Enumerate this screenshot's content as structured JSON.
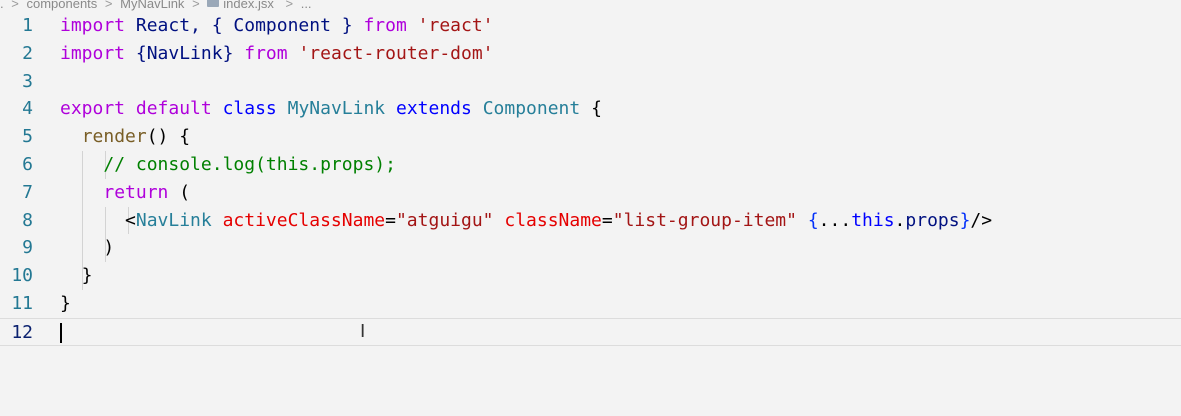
{
  "breadcrumb": {
    "items": [
      "components",
      "MyNavLink",
      "index.jsx",
      "..."
    ],
    "separator": ">"
  },
  "editor": {
    "language": "javascript-react",
    "cursor_line": 12,
    "lines": [
      {
        "number": "1",
        "segments": [
          {
            "t": "import",
            "c": "kw"
          },
          {
            "t": " React, { Component } ",
            "c": "id"
          },
          {
            "t": "from",
            "c": "kw"
          },
          {
            "t": " ",
            "c": "tx"
          },
          {
            "t": "'react'",
            "c": "st"
          }
        ]
      },
      {
        "number": "2",
        "segments": [
          {
            "t": "import",
            "c": "kw"
          },
          {
            "t": " {NavLink} ",
            "c": "id"
          },
          {
            "t": "from",
            "c": "kw"
          },
          {
            "t": " ",
            "c": "tx"
          },
          {
            "t": "'react-router-dom'",
            "c": "st"
          }
        ]
      },
      {
        "number": "3",
        "segments": []
      },
      {
        "number": "4",
        "segments": [
          {
            "t": "export",
            "c": "kw"
          },
          {
            "t": " ",
            "c": "tx"
          },
          {
            "t": "default",
            "c": "kw"
          },
          {
            "t": " ",
            "c": "tx"
          },
          {
            "t": "class",
            "c": "kb"
          },
          {
            "t": " ",
            "c": "tx"
          },
          {
            "t": "MyNavLink",
            "c": "ty"
          },
          {
            "t": " ",
            "c": "tx"
          },
          {
            "t": "extends",
            "c": "kb"
          },
          {
            "t": " ",
            "c": "tx"
          },
          {
            "t": "Component",
            "c": "ty"
          },
          {
            "t": " {",
            "c": "tx"
          }
        ]
      },
      {
        "number": "5",
        "segments": [
          {
            "t": "  ",
            "c": "tx"
          },
          {
            "t": "render",
            "c": "fn"
          },
          {
            "t": "() {",
            "c": "tx"
          }
        ]
      },
      {
        "number": "6",
        "segments": [
          {
            "t": "    ",
            "c": "tx"
          },
          {
            "t": "// console.log(this.props);",
            "c": "cm"
          }
        ]
      },
      {
        "number": "7",
        "segments": [
          {
            "t": "    ",
            "c": "tx"
          },
          {
            "t": "return",
            "c": "kw"
          },
          {
            "t": " (",
            "c": "tx"
          }
        ]
      },
      {
        "number": "8",
        "segments": [
          {
            "t": "      <",
            "c": "tx"
          },
          {
            "t": "NavLink",
            "c": "ty"
          },
          {
            "t": " ",
            "c": "tx"
          },
          {
            "t": "activeClassName",
            "c": "at"
          },
          {
            "t": "=",
            "c": "tx"
          },
          {
            "t": "\"atguigu\"",
            "c": "st"
          },
          {
            "t": " ",
            "c": "tx"
          },
          {
            "t": "className",
            "c": "at"
          },
          {
            "t": "=",
            "c": "tx"
          },
          {
            "t": "\"list-group-item\"",
            "c": "st"
          },
          {
            "t": " ",
            "c": "tx"
          },
          {
            "t": "{",
            "c": "br"
          },
          {
            "t": "...",
            "c": "tx"
          },
          {
            "t": "this",
            "c": "kb"
          },
          {
            "t": ".",
            "c": "tx"
          },
          {
            "t": "props",
            "c": "id"
          },
          {
            "t": "}",
            "c": "br"
          },
          {
            "t": "/>",
            "c": "tx"
          }
        ]
      },
      {
        "number": "9",
        "segments": [
          {
            "t": "    )",
            "c": "tx"
          }
        ]
      },
      {
        "number": "10",
        "segments": [
          {
            "t": "  }",
            "c": "tx"
          }
        ]
      },
      {
        "number": "11",
        "segments": [
          {
            "t": "}",
            "c": "tx"
          }
        ]
      },
      {
        "number": "12",
        "segments": []
      }
    ]
  },
  "colors": {
    "background": "#f3f3f3",
    "line_number": "#237893",
    "keyword": "#af00db",
    "string": "#a31515",
    "comment": "#008000",
    "type": "#267f99"
  }
}
